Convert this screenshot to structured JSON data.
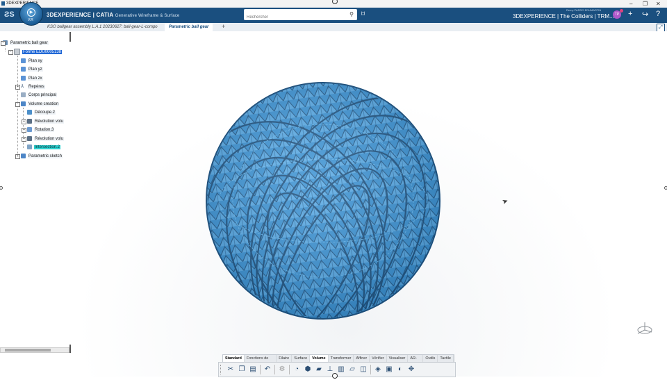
{
  "colors": {
    "top_bar": "#1a4f7f",
    "model_fill": "#3b92d3",
    "model_stroke": "#1c4f7c",
    "selection": "#1f67d6",
    "highlight": "#2dd1d0"
  },
  "window": {
    "title": "3DEXPERIENCE",
    "minimize": "–",
    "restore": "❐",
    "close": "✕"
  },
  "header": {
    "brand_main": "3DEXPERIENCE | CATIA",
    "brand_sub": "Generative Wireframe & Surface",
    "compass_label": "V.R",
    "search_placeholder": "Rechercher",
    "user_name": "Remy PARRO EDUMARTIN",
    "product_title": "3DEXPERIENCE | The Colliders | TRM...",
    "avatar_initials": "TP",
    "icons": [
      "search-icon",
      "tag-icon",
      "add-icon",
      "share-icon",
      "help-icon"
    ]
  },
  "tabs": [
    {
      "label": "KSO ballgear assembly L.A.1 20230627: ball-gear-L-compo",
      "active": false
    },
    {
      "label": "Parametric ball gear",
      "active": true
    }
  ],
  "tree": {
    "items": [
      {
        "label": "Parametric ball gear",
        "state": "normal",
        "icon": "product-icon"
      },
      {
        "label": "Forme EDU0005138",
        "state": "selected",
        "icon": "shape-icon"
      },
      {
        "label": "Plan xy",
        "state": "normal",
        "icon": "plane-icon"
      },
      {
        "label": "Plan yz",
        "state": "normal",
        "icon": "plane-icon"
      },
      {
        "label": "Plan zx",
        "state": "normal",
        "icon": "plane-icon"
      },
      {
        "label": "Repères",
        "state": "normal",
        "icon": "axis-icon"
      },
      {
        "label": "Corps principal",
        "state": "normal",
        "icon": "body-icon"
      },
      {
        "label": "Volume creation",
        "state": "normal",
        "icon": "geoset-icon"
      },
      {
        "label": "Découpe.2",
        "state": "normal",
        "icon": "split-icon"
      },
      {
        "label": "Révolution volu",
        "state": "normal",
        "icon": "revolve-icon"
      },
      {
        "label": "Rotation.3",
        "state": "normal",
        "icon": "rotation-icon"
      },
      {
        "label": "Révolution volu",
        "state": "normal",
        "icon": "revolve-icon"
      },
      {
        "label": "Intersection.2",
        "state": "highlighted",
        "icon": "intersection-icon"
      },
      {
        "label": "Parametric sketch",
        "state": "normal",
        "icon": "geoset-icon"
      }
    ]
  },
  "action_bar": {
    "tabs": [
      "Standard",
      "Fonctions de base",
      "Filaire",
      "Surface",
      "Volume",
      "Transformer",
      "Affiner",
      "Vérifier",
      "Visualiser",
      "AR-VR",
      "Outils",
      "Tactile"
    ],
    "active_tab": "Volume",
    "icons": [
      "cut-icon",
      "copy-icon",
      "paste-icon",
      "undo-icon",
      "update-icon",
      "revolve-icon",
      "extrude-icon",
      "pad-icon",
      "pocket-icon",
      "shell-icon",
      "thickness-icon",
      "box-icon",
      "split-icon",
      "boolean-icon",
      "fillet-icon",
      "transform-icon"
    ]
  }
}
